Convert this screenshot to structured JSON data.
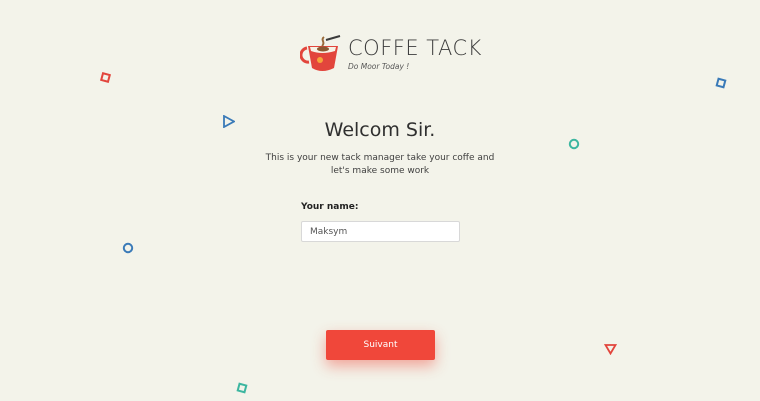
{
  "brand": {
    "title": "COFFE TACK",
    "tagline": "Do Moor Today !"
  },
  "welcome": {
    "heading": "Welcom Sir.",
    "subtitle": "This is your new tack manager take your coffe and let's make some work"
  },
  "form": {
    "name_label": "Your name:",
    "name_value": "Maksym"
  },
  "actions": {
    "next_label": "Suivant"
  },
  "colors": {
    "background": "#f3f3ea",
    "accent": "#f0473a",
    "blue": "#3a7ab8",
    "teal": "#3cb6a0",
    "red": "#e2453c"
  }
}
